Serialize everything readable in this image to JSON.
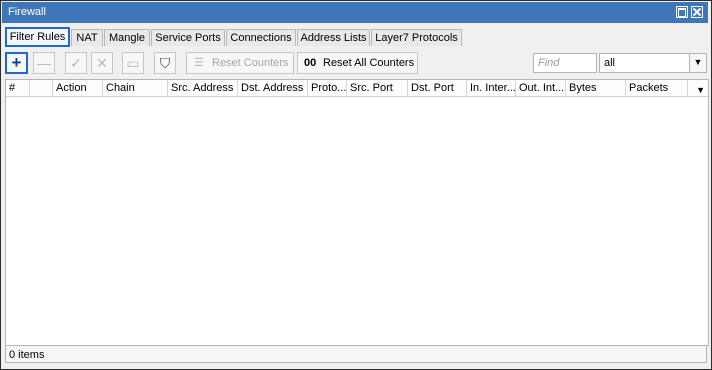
{
  "window": {
    "title": "Firewall"
  },
  "tabs": [
    "Filter Rules",
    "NAT",
    "Mangle",
    "Service Ports",
    "Connections",
    "Address Lists",
    "Layer7 Protocols"
  ],
  "toolbar": {
    "add_glyph": "+",
    "remove_glyph": "—",
    "enable_glyph": "✓",
    "disable_glyph": "✕",
    "comment_glyph": "▭",
    "filter_glyph": "⛉",
    "reset_counters_label": "Reset Counters",
    "reset_all_counters_icon": "00",
    "reset_all_counters_label": "Reset All Counters",
    "find_placeholder": "Find",
    "filter_select_value": "all",
    "dropdown_glyph": "▼"
  },
  "table": {
    "columns": [
      "#",
      "",
      "Action",
      "Chain",
      "Src. Address",
      "Dst. Address",
      "Proto...",
      "Src. Port",
      "Dst. Port",
      "In. Inter...",
      "Out. Int...",
      "Bytes",
      "Packets"
    ],
    "sort_glyph": "▼",
    "rows": []
  },
  "status": {
    "items_label": "0 items"
  },
  "colors": {
    "titlebar": "#3e77b9",
    "highlight": "#1b6ad4"
  }
}
